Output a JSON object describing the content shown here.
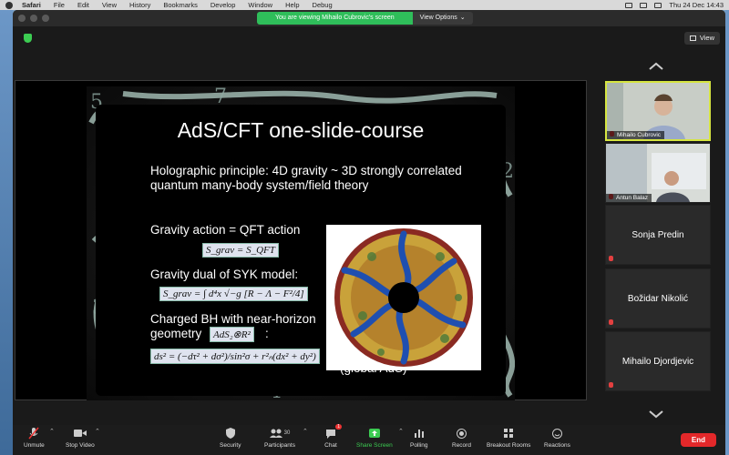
{
  "menubar": {
    "app": "Safari",
    "items": [
      "File",
      "Edit",
      "View",
      "History",
      "Bookmarks",
      "Develop",
      "Window",
      "Help",
      "Debug"
    ],
    "clock": "Thu 24 Dec  14:43"
  },
  "banner": {
    "message": "You are viewing Mihailo Cubrovic's screen",
    "options": "View Options"
  },
  "view_button": "View",
  "slide": {
    "title": "AdS/CFT one-slide-course",
    "holo_line1": "Holographic principle: 4D gravity ~ 3D strongly correlated",
    "holo_line2": "quantum many-body system/field theory",
    "gravity_action": "Gravity action = QFT action",
    "eq1": "S_grav = S_QFT",
    "syk": "Gravity dual of SYK model:",
    "eq2": "S_grav = ∫ d⁴x √−g [R − Λ − F²/4]",
    "charged_bh1": "Charged BH with near-horizon",
    "charged_bh2": "geometry",
    "eq3": "AdS₂⊗R²",
    "eq3_suffix": ":",
    "eq4": "ds² = (−dτ² + dσ²)/sin²σ + r²ₙ(dx² + dy²)",
    "global_label": "(global AdS)"
  },
  "participants": [
    {
      "name": "Mihailo Cubrovic",
      "video": true,
      "active": true
    },
    {
      "name": "Antun Balaz",
      "video": true,
      "active": false
    },
    {
      "name": "Sonja Predin",
      "video": false,
      "active": false
    },
    {
      "name": "Božidar Nikolić",
      "video": false,
      "active": false
    },
    {
      "name": "Mihailo Djordjevic",
      "video": false,
      "active": false
    }
  ],
  "toolbar": {
    "unmute": "Unmute",
    "stop_video": "Stop Video",
    "security": "Security",
    "participants": "Participants",
    "participants_count": "30",
    "chat": "Chat",
    "chat_badge": "1",
    "share_screen": "Share Screen",
    "polling": "Polling",
    "record": "Record",
    "breakout": "Breakout Rooms",
    "reactions": "Reactions",
    "end": "End"
  },
  "colors": {
    "share_green": "#2fbe5a",
    "end_red": "#e3282a",
    "active_speaker": "#d6e540"
  }
}
